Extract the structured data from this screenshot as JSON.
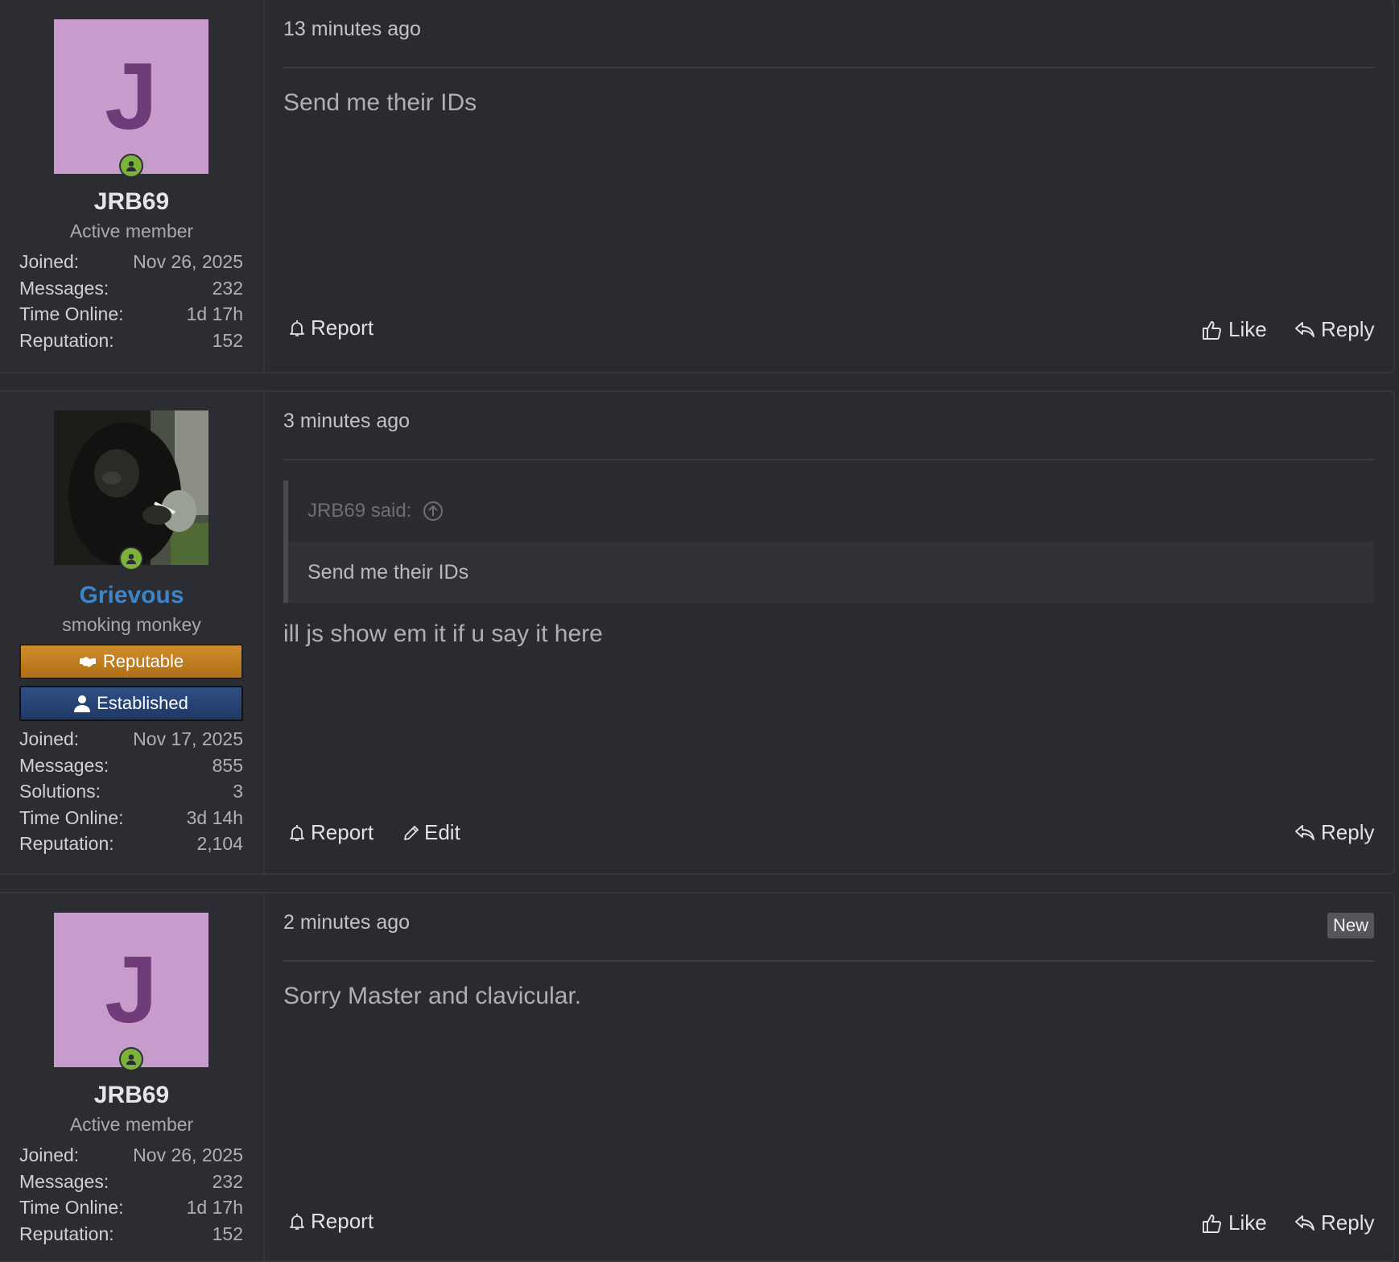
{
  "posts": [
    {
      "avatar_letter": "J",
      "avatar_bg": "#c79ccc",
      "username": "JRB69",
      "user_title": "Active member",
      "stats": [
        {
          "label": "Joined:",
          "value": "Nov 26, 2025"
        },
        {
          "label": "Messages:",
          "value": "232"
        },
        {
          "label": "Time Online:",
          "value": "1d 17h"
        },
        {
          "label": "Reputation:",
          "value": "152"
        }
      ],
      "timestamp": "13 minutes ago",
      "body": "Send me their IDs",
      "actions": {
        "report": "Report",
        "like": "Like",
        "reply": "Reply"
      }
    },
    {
      "avatar_icon": "chimpanzee-photo",
      "username": "Grievous",
      "username_color": "#3d85c6",
      "user_title": "smoking monkey",
      "banners": [
        {
          "label": "Reputable",
          "icon": "handshake-icon",
          "color": "#c0801f"
        },
        {
          "label": "Established",
          "icon": "user-icon",
          "color": "#264577"
        }
      ],
      "stats": [
        {
          "label": "Joined:",
          "value": "Nov 17, 2025"
        },
        {
          "label": "Messages:",
          "value": "855"
        },
        {
          "label": "Solutions:",
          "value": "3"
        },
        {
          "label": "Time Online:",
          "value": "3d 14h"
        },
        {
          "label": "Reputation:",
          "value": "2,104"
        }
      ],
      "timestamp": "3 minutes ago",
      "quote": {
        "author_line": "JRB69 said:",
        "text": "Send me their IDs"
      },
      "body": "ill js show em it if u say it here",
      "actions": {
        "report": "Report",
        "edit": "Edit",
        "reply": "Reply"
      }
    },
    {
      "avatar_letter": "J",
      "avatar_bg": "#c79ccc",
      "username": "JRB69",
      "user_title": "Active member",
      "stats": [
        {
          "label": "Joined:",
          "value": "Nov 26, 2025"
        },
        {
          "label": "Messages:",
          "value": "232"
        },
        {
          "label": "Time Online:",
          "value": "1d 17h"
        },
        {
          "label": "Reputation:",
          "value": "152"
        }
      ],
      "timestamp": "2 minutes ago",
      "badge": "New",
      "body": "Sorry Master and clavicular.",
      "actions": {
        "report": "Report",
        "like": "Like",
        "reply": "Reply"
      }
    }
  ],
  "colors": {
    "online": "#7bb23a",
    "background": "#2a2b30"
  }
}
